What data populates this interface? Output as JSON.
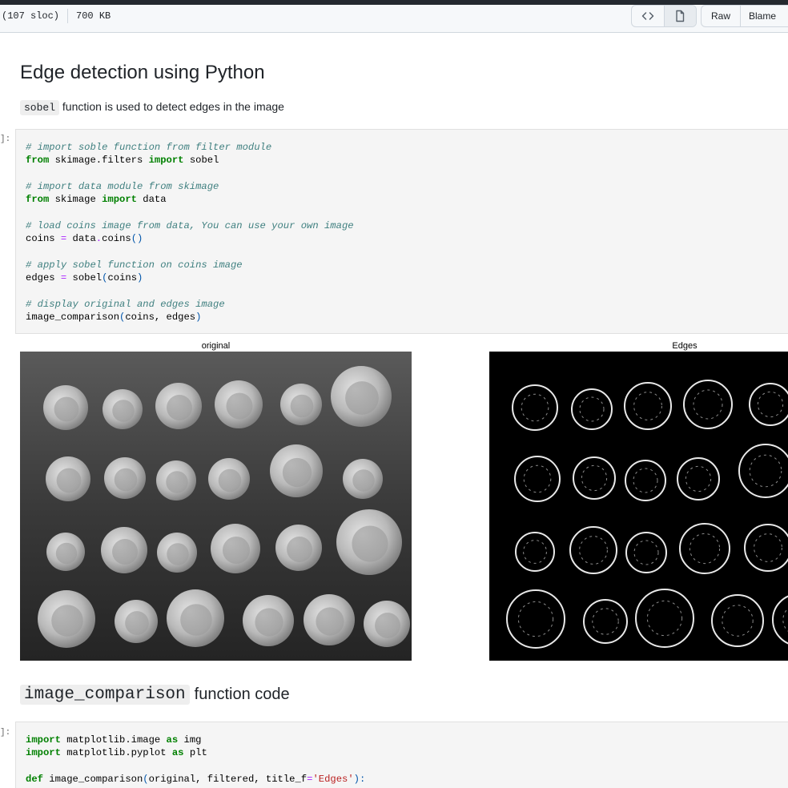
{
  "file_header": {
    "sloc": "(107 sloc)",
    "size": "700 KB",
    "code_view_icon": "code-icon",
    "file_view_icon": "file-icon",
    "raw_label": "Raw",
    "blame_label": "Blame"
  },
  "section1": {
    "title": "Edge detection using Python",
    "intro_code": "sobel",
    "intro_text": " function is used to detect edges in the image"
  },
  "cell1": {
    "prompt": "]:",
    "lines": [
      "# import soble function from filter module",
      "from skimage.filters import sobel",
      "",
      "# import data module from skimage",
      "from skimage import data",
      "",
      "# load coins image from data, You can use your own image",
      "coins = data.coins()",
      "",
      "# apply sobel function on coins image",
      "edges = sobel(coins)",
      "",
      "# display original and edges image",
      "image_comparison(coins, edges)"
    ]
  },
  "output1": {
    "left_title": "original",
    "right_title": "Edges",
    "left_image": "grayscale photo of 24 ancient coins on dark background",
    "right_image": "sobel edge map of coins, white outlines on black"
  },
  "section2": {
    "title_code": "image_comparison",
    "title_text": "function code"
  },
  "cell2": {
    "prompt": "]:",
    "lines": [
      "import matplotlib.image as img",
      "import matplotlib.pyplot as plt",
      "",
      "def image_comparison(original, filtered, title_f='Edges'):"
    ]
  }
}
